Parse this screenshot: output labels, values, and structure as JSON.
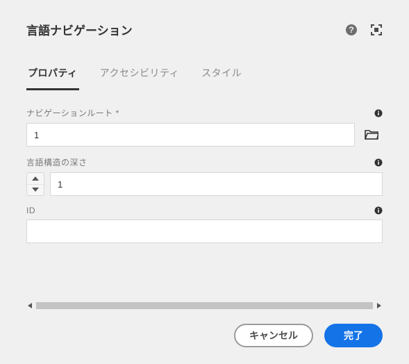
{
  "header": {
    "title": "言語ナビゲーション"
  },
  "tabs": [
    {
      "label": "プロパティ",
      "active": true
    },
    {
      "label": "アクセシビリティ",
      "active": false
    },
    {
      "label": "スタイル",
      "active": false
    }
  ],
  "fields": {
    "navigationRoot": {
      "label": "ナビゲーションルート *",
      "value": "1"
    },
    "structureDepth": {
      "label": "言語構造の深さ",
      "value": "1"
    },
    "id": {
      "label": "ID",
      "value": ""
    }
  },
  "footer": {
    "cancel": "キャンセル",
    "done": "完了"
  }
}
